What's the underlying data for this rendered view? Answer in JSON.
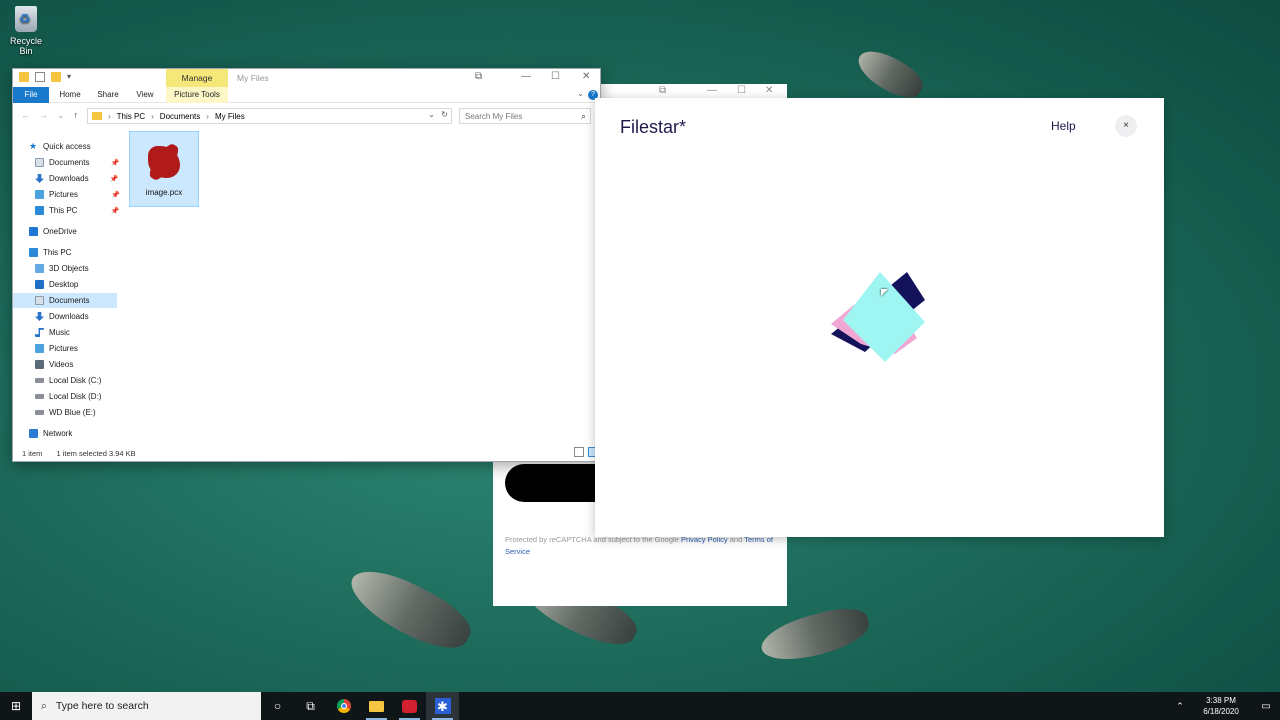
{
  "desktop": {
    "recycle_bin_label": "Recycle Bin"
  },
  "background_window": {
    "recaptcha_text": "Protected by reCAPTCHA and subject to the Google",
    "privacy_link": "Privacy Policy",
    "and_text": "and",
    "terms_link": "Terms of",
    "service_link": "Service"
  },
  "explorer": {
    "manage_tab": "Manage",
    "window_title": "My Files",
    "ribbon_tabs": [
      "File",
      "Home",
      "Share",
      "View",
      "Picture Tools"
    ],
    "breadcrumb": [
      "This PC",
      "Documents",
      "My Files"
    ],
    "search_placeholder": "Search My Files",
    "nav_items": [
      {
        "label": "Quick access",
        "icon": "star-icon"
      },
      {
        "label": "Documents",
        "icon": "documents-icon"
      },
      {
        "label": "Downloads",
        "icon": "downloads-icon"
      },
      {
        "label": "Pictures",
        "icon": "pictures-icon"
      },
      {
        "label": "This PC",
        "icon": "this-pc-icon"
      },
      {
        "label": "OneDrive",
        "icon": "cloud-icon"
      },
      {
        "label": "This PC",
        "icon": "this-pc-icon"
      },
      {
        "label": "3D Objects",
        "icon": "3d-objects-icon"
      },
      {
        "label": "Desktop",
        "icon": "desktop-icon"
      },
      {
        "label": "Documents",
        "icon": "documents-icon"
      },
      {
        "label": "Downloads",
        "icon": "downloads-icon"
      },
      {
        "label": "Music",
        "icon": "music-icon"
      },
      {
        "label": "Pictures",
        "icon": "pictures-icon"
      },
      {
        "label": "Videos",
        "icon": "videos-icon"
      },
      {
        "label": "Local Disk (C:)",
        "icon": "drive-icon"
      },
      {
        "label": "Local Disk (D:)",
        "icon": "drive-icon"
      },
      {
        "label": "WD Blue (E:)",
        "icon": "drive-icon"
      },
      {
        "label": "Network",
        "icon": "network-icon"
      }
    ],
    "file": {
      "name": "image.pcx"
    },
    "status": {
      "count": "1 item",
      "selected": "1 item selected",
      "size": "3.94 KB"
    }
  },
  "filestar": {
    "title": "Filestar*",
    "help_label": "Help",
    "close_label": "×",
    "logo_colors": {
      "navy": "#15125c",
      "pink": "#f0a7d4",
      "cyan": "#9ff5f2"
    }
  },
  "taskbar": {
    "search_placeholder": "Type here to search",
    "time": "3:38 PM",
    "date": "6/18/2020",
    "apps": [
      "cortana-icon",
      "task-view-icon",
      "chrome-icon",
      "file-explorer-icon",
      "red-app-icon",
      "filestar-icon"
    ]
  }
}
